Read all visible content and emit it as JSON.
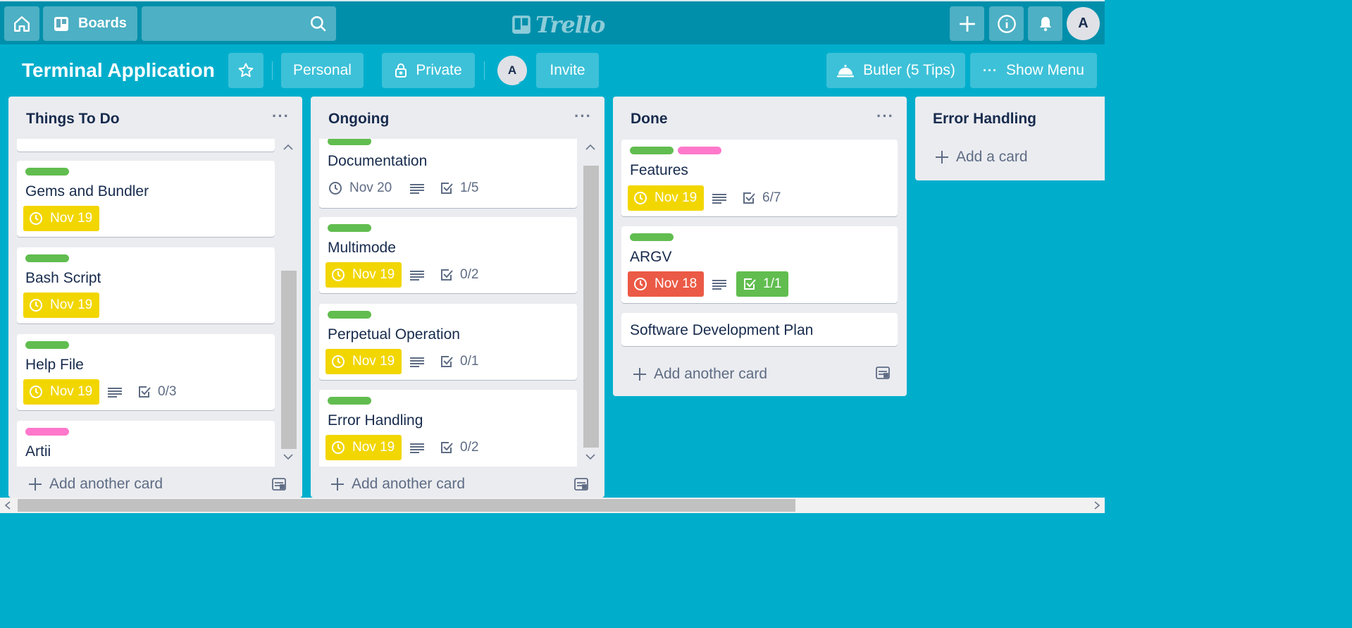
{
  "header": {
    "boards_label": "Boards",
    "logo_text": "Trello",
    "avatar_initial": "A",
    "icons": [
      "home-icon",
      "boards-icon",
      "search-icon",
      "plus-icon",
      "info-icon",
      "bell-icon"
    ]
  },
  "board": {
    "title": "Terminal Application",
    "personal_label": "Personal",
    "private_label": "Private",
    "member_initial": "A",
    "invite_label": "Invite",
    "butler_label": "Butler (5 Tips)",
    "menu_label": "Show Menu"
  },
  "colors": {
    "background": "#00aecc",
    "label_green": "#61bd4f",
    "label_pink": "#ff78cb",
    "due_yellow": "#f2d600",
    "due_red": "#eb5a46"
  },
  "lists": [
    {
      "title": "Things To Do",
      "add_label": "Add another card",
      "cards": [
        {
          "title": "Gems and Bundler",
          "labels": [
            "green"
          ],
          "due": "Nov 19"
        },
        {
          "title": "Bash Script",
          "labels": [
            "green"
          ],
          "due": "Nov 19"
        },
        {
          "title": "Help File",
          "labels": [
            "green"
          ],
          "due": "Nov 19",
          "checklist": "0/3"
        },
        {
          "title": "Artii",
          "labels": [
            "pink"
          ]
        }
      ]
    },
    {
      "title": "Ongoing",
      "add_label": "Add another card",
      "cards": [
        {
          "title": "Documentation",
          "labels": [
            "green"
          ],
          "due": "Nov 20",
          "checklist": "1/5"
        },
        {
          "title": "Multimode",
          "labels": [
            "green"
          ],
          "due": "Nov 19",
          "checklist": "0/2"
        },
        {
          "title": "Perpetual Operation",
          "labels": [
            "green"
          ],
          "due": "Nov 19",
          "checklist": "0/1"
        },
        {
          "title": "Error Handling",
          "labels": [
            "green"
          ],
          "due": "Nov 19",
          "checklist": "0/2"
        }
      ]
    },
    {
      "title": "Done",
      "add_label": "Add another card",
      "cards": [
        {
          "title": "Features",
          "labels": [
            "green",
            "pink"
          ],
          "due": "Nov 19",
          "checklist": "6/7"
        },
        {
          "title": "ARGV",
          "labels": [
            "green"
          ],
          "due": "Nov 18",
          "checklist": "1/1"
        },
        {
          "title": "Software Development Plan"
        }
      ]
    },
    {
      "title": "Error Handling",
      "add_label": "Add a card",
      "cards": []
    }
  ]
}
